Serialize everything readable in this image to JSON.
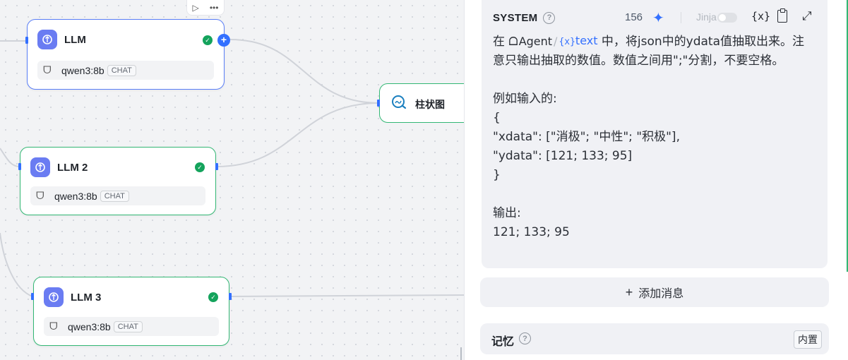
{
  "canvas": {
    "toolbar": {
      "run_icon": "play-icon",
      "more_icon": "ellipsis-icon"
    },
    "nodes": [
      {
        "id": "llm1",
        "title": "LLM",
        "model": "qwen3:8b",
        "tag": "CHAT",
        "status": "success",
        "selected": true
      },
      {
        "id": "llm2",
        "title": "LLM 2",
        "model": "qwen3:8b",
        "tag": "CHAT",
        "status": "success",
        "selected": false
      },
      {
        "id": "llm3",
        "title": "LLM 3",
        "model": "qwen3:8b",
        "tag": "CHAT",
        "status": "success",
        "selected": false
      }
    ],
    "chart_node": {
      "title": "柱状图",
      "icon": "chart-search-icon"
    }
  },
  "panel": {
    "system": {
      "label": "SYSTEM",
      "token_count": "156",
      "jinja_label": "Jinja",
      "jinja_enabled": false,
      "var_icon_label": "{x}",
      "body_prefix": "在 ",
      "ref_agent": "Agent",
      "ref_var": "text",
      "body_rest": " 中，将json中的ydata值抽取出来。注意只输出抽取的数值。数值之间用\";\"分割，不要空格。\n\n例如输入的:\n{\n\"xdata\": [\"消极\"; \"中性\"; \"积极\"],\n\"ydata\": [121; 133; 95]\n}\n\n输出:\n121; 133; 95"
    },
    "add_message": "添加消息",
    "memory": {
      "title": "记忆",
      "badge": "内置"
    }
  },
  "colors": {
    "accent": "#3370ff",
    "success": "#14a35c",
    "node_border": "#33b774",
    "llm_icon_bg": "#6a7cf2"
  }
}
